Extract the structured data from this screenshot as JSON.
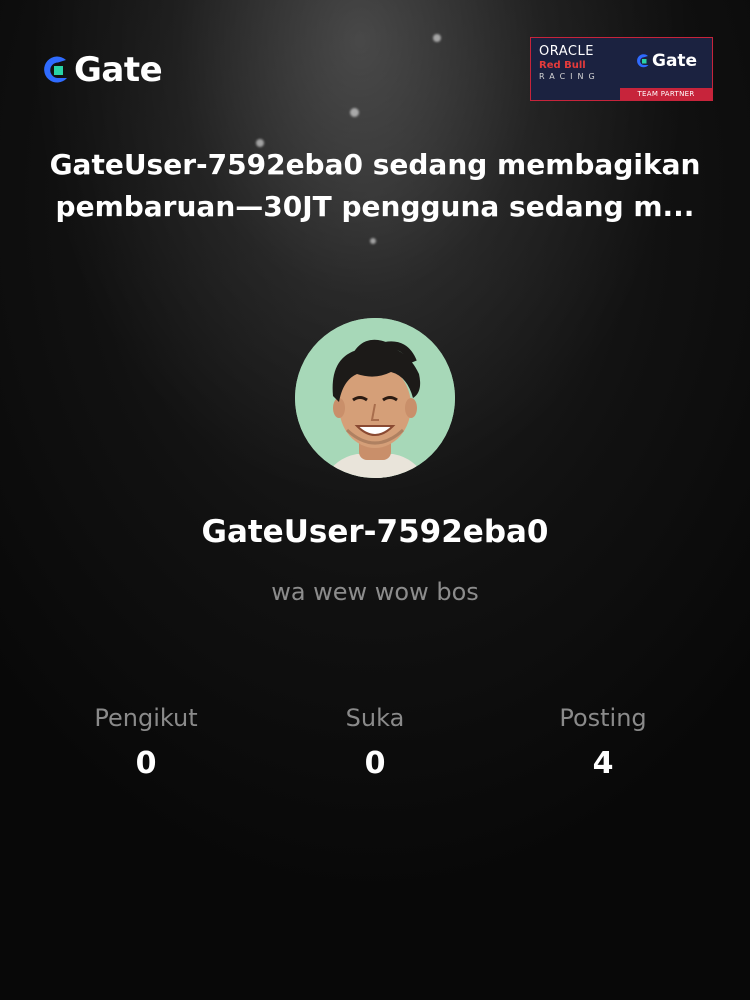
{
  "brand": {
    "name": "Gate",
    "icon": "gate-logo-icon",
    "accent": "#2f6bff",
    "accent_light": "#29d3a6"
  },
  "partner_badge": {
    "line1": "ORACLE",
    "line2": "Red Bull",
    "line3": "RACING",
    "brand": "Gate",
    "tag": "TEAM PARTNER",
    "background": "#1b2240",
    "tag_color": "#c7243b"
  },
  "headline": "GateUser-7592eba0 sedang membagikan pembaruan—30JT pengguna sedang m...",
  "profile": {
    "avatar_icon": "avatar-photo",
    "username": "GateUser-7592eba0",
    "bio": "wa wew wow bos"
  },
  "stats": [
    {
      "label": "Pengikut",
      "value": "0"
    },
    {
      "label": "Suka",
      "value": "0"
    },
    {
      "label": "Posting",
      "value": "4"
    }
  ]
}
